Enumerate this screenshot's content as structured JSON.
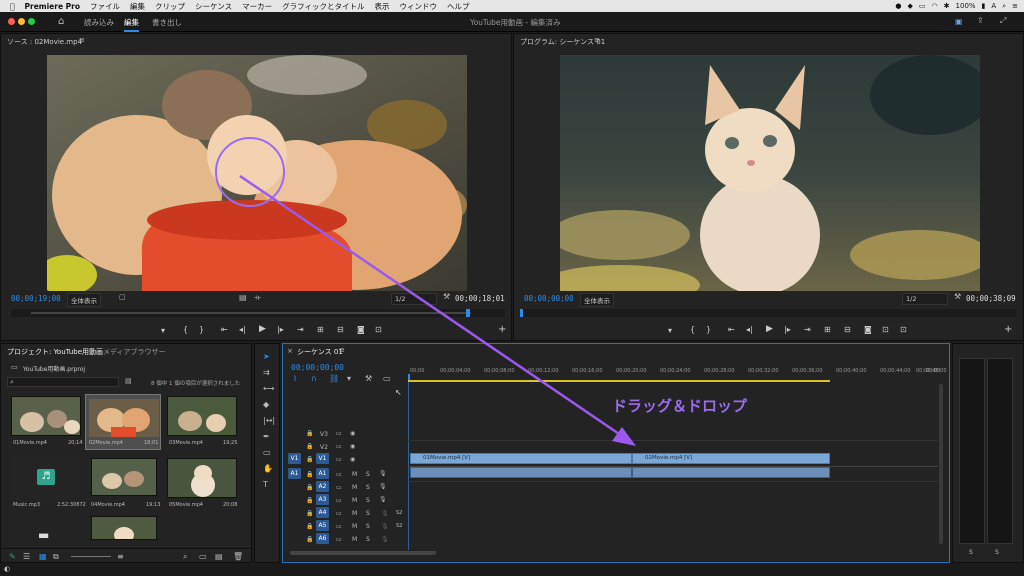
{
  "menubar": {
    "app": "Premiere Pro",
    "items": [
      "ファイル",
      "編集",
      "クリップ",
      "シーケンス",
      "マーカー",
      "グラフィックとタイトル",
      "表示",
      "ウィンドウ",
      "ヘルプ"
    ],
    "battery": "100%"
  },
  "workspace": {
    "tabs": [
      "読み込み",
      "編集",
      "書き出し"
    ],
    "active_tab": "編集",
    "title": "YouTube用動画 - 編集済み"
  },
  "source_monitor": {
    "title": "ソース : 02Movie.mp4",
    "timecode_left": "00;00;19;00",
    "zoom": "全体表示",
    "resolution": "1/2",
    "timecode_right": "00;00;18;01"
  },
  "program_monitor": {
    "title": "プログラム: シーケンス 01",
    "timecode_left": "00;00;00;00",
    "zoom": "全体表示",
    "resolution": "1/2",
    "timecode_right": "00;00;38;09"
  },
  "project": {
    "title": "プロジェクト: YouTube用動画",
    "tab2": "メディアブラウザー",
    "file": "YouTube用動画.prproj",
    "selection_info": "8 個中 1 個の項目が選択されました",
    "items": [
      {
        "name": "01Movie.mp4",
        "dur": "20;14"
      },
      {
        "name": "02Movie.mp4",
        "dur": "18;01"
      },
      {
        "name": "03Movie.mp4",
        "dur": "19;25"
      },
      {
        "name": "Music.mp3",
        "dur": "2:52:30872"
      },
      {
        "name": "04Movie.mp4",
        "dur": "19;13"
      },
      {
        "name": "05Movie.mp4",
        "dur": "20;08"
      }
    ]
  },
  "timeline": {
    "title": "シーケンス 01",
    "timecode": "00;00;00;00",
    "ruler": [
      "00;00",
      "00;00;04;00",
      "00;00;08;00",
      "00;00;12;00",
      "00;00;16;00",
      "00;00;20;00",
      "00;00;24;00",
      "00;00;28;00",
      "00;00;32;00",
      "00;00;36;00",
      "00;00;40;00",
      "00;00;44;00",
      "00;00;48;00",
      "00;00"
    ],
    "video_tracks": [
      "V3",
      "V2",
      "V1"
    ],
    "audio_tracks": [
      "A1",
      "A2",
      "A3",
      "A4",
      "A5",
      "A6"
    ],
    "source_v": "V1",
    "source_a": "A1",
    "clips": [
      "01Movie.mp4 [V]",
      "02Movie.mp4 [V]"
    ],
    "track_letters": {
      "m": "M",
      "s": "S"
    },
    "s2_label": "S2"
  },
  "annotation": {
    "text": "ドラッグ＆ドロップ"
  },
  "audio_meter": {
    "labels": [
      "S",
      "S"
    ]
  }
}
